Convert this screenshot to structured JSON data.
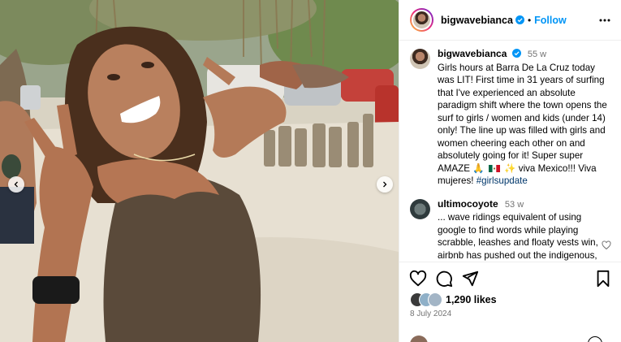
{
  "post": {
    "author": "bigwavebianca",
    "follow_label": "Follow",
    "separator": "•"
  },
  "comments": [
    {
      "username": "bigwavebianca",
      "age": "55 w",
      "text_before_emoji": "Girls hours at Barra De La Cruz today was LIT! First time in 31 years of surfing that I've experienced an absolute paradigm shift where the town opens the surf to girls / women and kids (under 14) only! The line up was filled with girls and women cheering each other on and absolutely going for it! Super super AMAZE",
      "emoji": "🙏",
      "emoji2": "✨",
      "text_after_emoji": " viva Mexico!!! Viva mujeres! ",
      "hashtag": "#girlsupdate"
    },
    {
      "username": "ultimocoyote",
      "age": "53 w",
      "text": "... wave ridings equivalent of using google to find words while playing scrabble, leashes and floaty vests win, airbnb has pushed out the indigenous, hope it's worth a few..."
    }
  ],
  "engagement": {
    "likes": "1,290 likes",
    "date": "8 July 2024"
  },
  "icons": {
    "verified": "verified-badge-icon",
    "more": "more-options-icon",
    "like": "heart-icon",
    "comment": "comment-icon",
    "share": "share-icon",
    "save": "bookmark-icon",
    "prev": "chevron-left-icon",
    "next": "chevron-right-icon"
  },
  "colors": {
    "accent": "#0095f6",
    "hashtag": "#00376b",
    "muted": "#737373",
    "border": "#efefef"
  }
}
